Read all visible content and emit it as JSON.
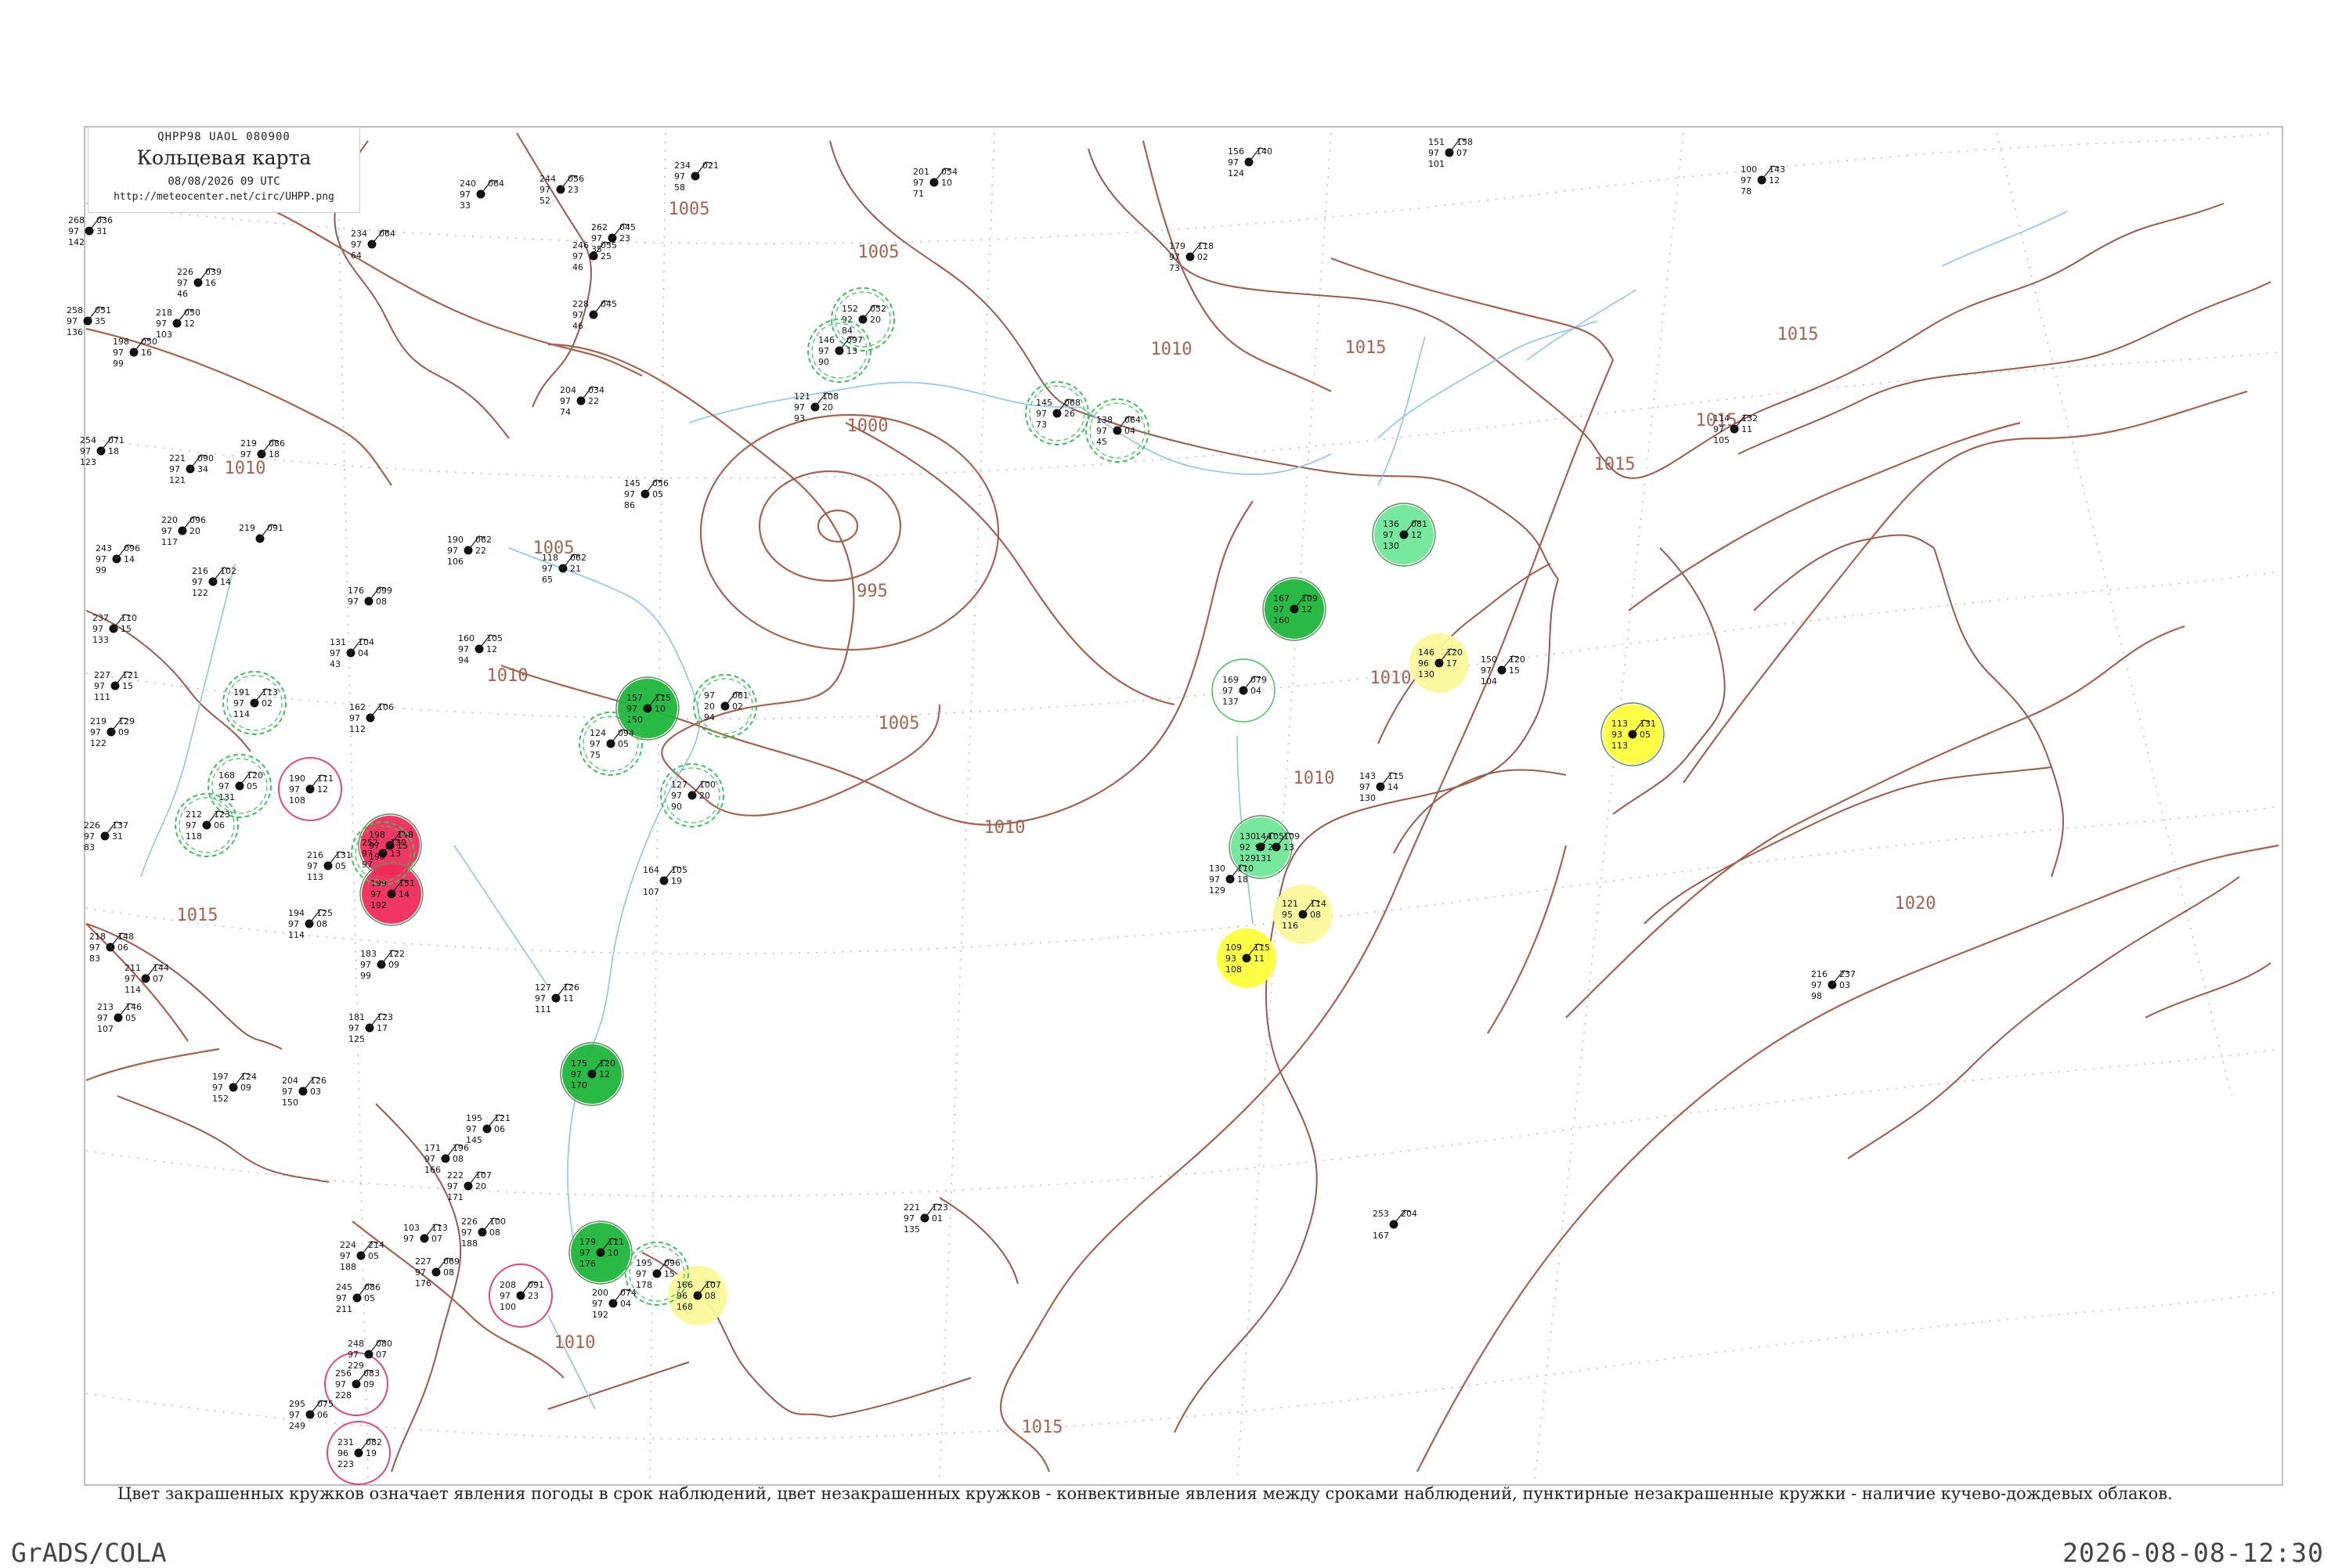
{
  "header": {
    "code": "QHPP98  UAOL  080900",
    "title": "Кольцевая карта",
    "date": "08/08/2026 09 UTC",
    "url": "http://meteocenter.net/circ/UHPP.png"
  },
  "caption": "Цвет закрашенных кружков означает явления погоды в срок наблюдений, цвет незакрашенных кружков - конвективные явления между сроками наблюдений, пунктирные незакрашенные кружки - наличие кучево-дождевых облаков.",
  "footer": {
    "left": "GrADS/COLA",
    "right": "2026-08-08-12:30"
  },
  "colors": {
    "isobar": "#a5624f",
    "river": "#8fc3e8",
    "coast": "#9a5a4a",
    "grid": "#b0b0b0",
    "shower_green": "#1cb63a",
    "light_green": "#6fe89a",
    "rain_yellow": "#ffff3c",
    "pale_yellow": "#fbf89a",
    "thunder_red": "#ef2b5a",
    "dashed_cb": "#3fbf5a",
    "pink_ring": "#e0487a"
  },
  "isobar_labels": [
    "1005",
    "1005",
    "1010",
    "1010",
    "1000",
    "995",
    "1005",
    "1010",
    "1015",
    "1015",
    "1015",
    "1015",
    "1010",
    "1010",
    "1010",
    "1015",
    "1020",
    "1005",
    "1010",
    "1015"
  ],
  "stations": [
    {
      "t": "136",
      "p": "081",
      "v": "97",
      "d": "130",
      "x": "12",
      "fill": "light",
      "ring": "solid"
    },
    {
      "t": "167",
      "p": "109",
      "v": "97",
      "d": "160",
      "x": "12",
      "fill": "green",
      "ring": "solid"
    },
    {
      "t": "146",
      "p": "120",
      "v": "96",
      "d": "130",
      "x": "17",
      "fill": "paleyellow",
      "ring": "none"
    },
    {
      "t": "113",
      "p": "131",
      "v": "93",
      "d": "113",
      "x": "05",
      "fill": "yellow",
      "ring": "solid"
    },
    {
      "t": "130",
      "p": "105",
      "v": "92",
      "d": "129",
      "x": "22",
      "fill": "light",
      "ring": "solid"
    },
    {
      "t": "121",
      "p": "114",
      "v": "95",
      "d": "116",
      "x": "08",
      "fill": "paleyellow",
      "ring": "none"
    },
    {
      "t": "109",
      "p": "115",
      "v": "93",
      "d": "108",
      "x": "11",
      "fill": "yellow",
      "ring": "none"
    },
    {
      "t": "157",
      "p": "115",
      "v": "97",
      "d": "150",
      "x": "10",
      "fill": "green",
      "ring": "solid"
    },
    {
      "t": "179",
      "p": "111",
      "v": "97",
      "d": "176",
      "x": "10",
      "fill": "green",
      "ring": "solid"
    },
    {
      "t": "175",
      "p": "120",
      "v": "97",
      "d": "170",
      "x": "12",
      "fill": "green",
      "ring": "solid"
    },
    {
      "t": "198",
      "p": "148",
      "v": "97",
      "d": "190",
      "x": "15",
      "fill": "red",
      "ring": "solid"
    },
    {
      "t": "199",
      "p": "151",
      "v": "97",
      "d": "192",
      "x": "14",
      "fill": "red",
      "ring": "solid"
    },
    {
      "t": "166",
      "p": "107",
      "v": "96",
      "d": "168",
      "x": "08",
      "fill": "paleyellow",
      "ring": "none"
    },
    {
      "t": "152",
      "p": "052",
      "v": "92",
      "d": "84",
      "x": "20",
      "fill": "none",
      "ring": "dashed"
    },
    {
      "t": "146",
      "p": "097",
      "v": "97",
      "d": "90",
      "x": "13",
      "fill": "none",
      "ring": "dashed"
    },
    {
      "t": "145",
      "p": "068",
      "v": "97",
      "d": "73",
      "x": "26",
      "fill": "none",
      "ring": "dashed"
    },
    {
      "t": "138",
      "p": "064",
      "v": "97",
      "d": "45",
      "x": "04",
      "fill": "none",
      "ring": "dashed"
    },
    {
      "t": "169",
      "p": "079",
      "v": "97",
      "d": "137",
      "x": "04",
      "fill": "none",
      "ring": "solid"
    },
    {
      "t": "97",
      "p": "061",
      "v": "20",
      "d": "94",
      "x": "02",
      "fill": "none",
      "ring": "dashed"
    },
    {
      "t": "124",
      "p": "094",
      "v": "97",
      "d": "75",
      "x": "05",
      "fill": "none",
      "ring": "dashed"
    },
    {
      "t": "127",
      "p": "100",
      "v": "97",
      "d": "90",
      "x": "20",
      "fill": "none",
      "ring": "dashed"
    },
    {
      "t": "190",
      "p": "111",
      "v": "97",
      "d": "108",
      "x": "12",
      "fill": "none",
      "ring": "pink"
    },
    {
      "t": "168",
      "p": "120",
      "v": "97",
      "d": "131",
      "x": "05",
      "fill": "none",
      "ring": "dashed"
    },
    {
      "t": "212",
      "p": "123",
      "v": "97",
      "d": "118",
      "x": "06",
      "fill": "none",
      "ring": "dashed"
    },
    {
      "t": "191",
      "p": "113",
      "v": "97",
      "d": "114",
      "x": "02",
      "fill": "none",
      "ring": "dashed"
    },
    {
      "t": "252",
      "p": "130",
      "v": "97",
      "d": "97",
      "x": "13",
      "fill": "none",
      "ring": "dashed"
    },
    {
      "t": "208",
      "p": "091",
      "v": "97",
      "d": "100",
      "x": "23",
      "fill": "none",
      "ring": "pink"
    },
    {
      "t": "195",
      "p": "096",
      "v": "97",
      "d": "178",
      "x": "15",
      "fill": "none",
      "ring": "dashed"
    },
    {
      "t": "256",
      "p": "083",
      "v": "97",
      "d": "228",
      "x": "09",
      "fill": "none",
      "ring": "pink"
    },
    {
      "t": "231",
      "p": "082",
      "v": "96",
      "d": "223",
      "x": "19",
      "fill": "none",
      "ring": "pink"
    },
    {
      "t": "221",
      "p": "123",
      "v": "97",
      "d": "135",
      "x": "01",
      "fill": "none",
      "ring": "none"
    },
    {
      "t": "253",
      "p": "204",
      "v": "",
      "d": "167",
      "x": "",
      "fill": "none",
      "ring": "none"
    },
    {
      "t": "216",
      "p": "237",
      "v": "97",
      "d": "98",
      "x": "03",
      "fill": "none",
      "ring": "none"
    },
    {
      "t": "156",
      "p": "140",
      "v": "97",
      "d": "124",
      "x": "",
      "fill": "none",
      "ring": "none"
    },
    {
      "t": "151",
      "p": "158",
      "v": "97",
      "d": "101",
      "x": "07",
      "fill": "none",
      "ring": "none"
    },
    {
      "t": "100",
      "p": "143",
      "v": "97",
      "d": "78",
      "x": "12",
      "fill": "none",
      "ring": "none"
    },
    {
      "t": "114",
      "p": "132",
      "v": "97",
      "d": "105",
      "x": "11",
      "fill": "none",
      "ring": "none"
    },
    {
      "t": "143",
      "p": "115",
      "v": "97",
      "d": "130",
      "x": "14",
      "fill": "none",
      "ring": "none"
    },
    {
      "t": "150",
      "p": "120",
      "v": "97",
      "d": "104",
      "x": "15",
      "fill": "none",
      "ring": "none"
    },
    {
      "t": "144",
      "p": "109",
      "v": "97",
      "d": "131",
      "x": "13",
      "fill": "none",
      "ring": "none"
    },
    {
      "t": "130",
      "p": "110",
      "v": "97",
      "d": "129",
      "x": "18",
      "fill": "none",
      "ring": "none"
    },
    {
      "t": "201",
      "p": "054",
      "v": "97",
      "d": "71",
      "x": "10",
      "fill": "none",
      "ring": "none"
    },
    {
      "t": "179",
      "p": "118",
      "v": "97",
      "d": "73",
      "x": "02",
      "fill": "none",
      "ring": "none"
    },
    {
      "t": "121",
      "p": "108",
      "v": "97",
      "d": "93",
      "x": "20",
      "fill": "none",
      "ring": "none"
    },
    {
      "t": "145",
      "p": "056",
      "v": "97",
      "d": "86",
      "x": "05",
      "fill": "none",
      "ring": "none"
    },
    {
      "t": "234",
      "p": "021",
      "v": "97",
      "d": "58",
      "x": "",
      "fill": "none",
      "ring": "none"
    },
    {
      "t": "240",
      "p": "064",
      "v": "97",
      "d": "33",
      "x": "",
      "fill": "none",
      "ring": "none"
    },
    {
      "t": "244",
      "p": "056",
      "v": "97",
      "d": "52",
      "x": "23",
      "fill": "none",
      "ring": "none"
    },
    {
      "t": "262",
      "p": "045",
      "v": "97",
      "d": "35",
      "x": "23",
      "fill": "none",
      "ring": "none"
    },
    {
      "t": "246",
      "p": "055",
      "v": "97",
      "d": "46",
      "x": "25",
      "fill": "none",
      "ring": "none"
    },
    {
      "t": "228",
      "p": "045",
      "v": "97",
      "d": "46",
      "x": "",
      "fill": "none",
      "ring": "none"
    },
    {
      "t": "204",
      "p": "034",
      "v": "97",
      "d": "74",
      "x": "22",
      "fill": "none",
      "ring": "none"
    },
    {
      "t": "268",
      "p": "036",
      "v": "97",
      "d": "142",
      "x": "31",
      "fill": "none",
      "ring": "none"
    },
    {
      "t": "234",
      "p": "064",
      "v": "97",
      "d": "64",
      "x": "",
      "fill": "none",
      "ring": "none"
    },
    {
      "t": "226",
      "p": "039",
      "v": "97",
      "d": "46",
      "x": "16",
      "fill": "none",
      "ring": "none"
    },
    {
      "t": "258",
      "p": "051",
      "v": "97",
      "d": "136",
      "x": "35",
      "fill": "none",
      "ring": "none"
    },
    {
      "t": "218",
      "p": "050",
      "v": "97",
      "d": "103",
      "x": "12",
      "fill": "none",
      "ring": "none"
    },
    {
      "t": "198",
      "p": "050",
      "v": "97",
      "d": "99",
      "x": "16",
      "fill": "none",
      "ring": "none"
    },
    {
      "t": "254",
      "p": "071",
      "v": "97",
      "d": "123",
      "x": "18",
      "fill": "none",
      "ring": "none"
    },
    {
      "t": "221",
      "p": "090",
      "v": "97",
      "d": "121",
      "x": "34",
      "fill": "none",
      "ring": "none"
    },
    {
      "t": "219",
      "p": "086",
      "v": "97",
      "d": "",
      "x": "18",
      "fill": "none",
      "ring": "none"
    },
    {
      "t": "220",
      "p": "096",
      "v": "97",
      "d": "117",
      "x": "20",
      "fill": "none",
      "ring": "none"
    },
    {
      "t": "243",
      "p": "096",
      "v": "97",
      "d": "99",
      "x": "14",
      "fill": "none",
      "ring": "none"
    },
    {
      "t": "219",
      "p": "091",
      "v": "",
      "d": "",
      "x": "",
      "fill": "none",
      "ring": "none"
    },
    {
      "t": "216",
      "p": "102",
      "v": "97",
      "d": "122",
      "x": "14",
      "fill": "none",
      "ring": "none"
    },
    {
      "t": "237",
      "p": "110",
      "v": "97",
      "d": "133",
      "x": "15",
      "fill": "none",
      "ring": "none"
    },
    {
      "t": "176",
      "p": "099",
      "v": "97",
      "d": "",
      "x": "08",
      "fill": "none",
      "ring": "none"
    },
    {
      "t": "190",
      "p": "062",
      "v": "97",
      "d": "106",
      "x": "22",
      "fill": "none",
      "ring": "none"
    },
    {
      "t": "118",
      "p": "062",
      "v": "97",
      "d": "65",
      "x": "21",
      "fill": "none",
      "ring": "none"
    },
    {
      "t": "160",
      "p": "105",
      "v": "97",
      "d": "94",
      "x": "12",
      "fill": "none",
      "ring": "none"
    },
    {
      "t": "131",
      "p": "104",
      "v": "97",
      "d": "43",
      "x": "04",
      "fill": "none",
      "ring": "none"
    },
    {
      "t": "227",
      "p": "121",
      "v": "97",
      "d": "111",
      "x": "15",
      "fill": "none",
      "ring": "none"
    },
    {
      "t": "219",
      "p": "129",
      "v": "97",
      "d": "122",
      "x": "09",
      "fill": "none",
      "ring": "none"
    },
    {
      "t": "226",
      "p": "137",
      "v": "97",
      "d": "83",
      "x": "31",
      "fill": "none",
      "ring": "none"
    },
    {
      "t": "162",
      "p": "106",
      "v": "97",
      "d": "112",
      "x": "",
      "fill": "none",
      "ring": "none"
    },
    {
      "t": "216",
      "p": "131",
      "v": "97",
      "d": "113",
      "x": "05",
      "fill": "none",
      "ring": "none"
    },
    {
      "t": "194",
      "p": "125",
      "v": "97",
      "d": "114",
      "x": "08",
      "fill": "none",
      "ring": "none"
    },
    {
      "t": "183",
      "p": "122",
      "v": "97",
      "d": "99",
      "x": "09",
      "fill": "none",
      "ring": "none"
    },
    {
      "t": "181",
      "p": "123",
      "v": "97",
      "d": "125",
      "x": "17",
      "fill": "none",
      "ring": "none"
    },
    {
      "t": "204",
      "p": "126",
      "v": "97",
      "d": "150",
      "x": "03",
      "fill": "none",
      "ring": "none"
    },
    {
      "t": "197",
      "p": "124",
      "v": "97",
      "d": "152",
      "x": "09",
      "fill": "none",
      "ring": "none"
    },
    {
      "t": "213",
      "p": "146",
      "v": "97",
      "d": "107",
      "x": "05",
      "fill": "none",
      "ring": "none"
    },
    {
      "t": "211",
      "p": "144",
      "v": "97",
      "d": "114",
      "x": "07",
      "fill": "none",
      "ring": "none"
    },
    {
      "t": "218",
      "p": "148",
      "v": "97",
      "d": "83",
      "x": "06",
      "fill": "none",
      "ring": "none"
    },
    {
      "t": "127",
      "p": "126",
      "v": "97",
      "d": "111",
      "x": "11",
      "fill": "none",
      "ring": "none"
    },
    {
      "t": "164",
      "p": "105",
      "v": "",
      "d": "107",
      "x": "19",
      "fill": "none",
      "ring": "none"
    },
    {
      "t": "195",
      "p": "121",
      "v": "97",
      "d": "145",
      "x": "06",
      "fill": "none",
      "ring": "none"
    },
    {
      "t": "171",
      "p": "196",
      "v": "97",
      "d": "166",
      "x": "08",
      "fill": "none",
      "ring": "none"
    },
    {
      "t": "222",
      "p": "107",
      "v": "97",
      "d": "171",
      "x": "20",
      "fill": "none",
      "ring": "none"
    },
    {
      "t": "226",
      "p": "100",
      "v": "97",
      "d": "188",
      "x": "08",
      "fill": "none",
      "ring": "none"
    },
    {
      "t": "224",
      "p": "214",
      "v": "97",
      "d": "188",
      "x": "05",
      "fill": "none",
      "ring": "none"
    },
    {
      "t": "103",
      "p": "113",
      "v": "97",
      "d": "",
      "x": "07",
      "fill": "none",
      "ring": "none"
    },
    {
      "t": "227",
      "p": "069",
      "v": "97",
      "d": "176",
      "x": "08",
      "fill": "none",
      "ring": "none"
    },
    {
      "t": "245",
      "p": "086",
      "v": "97",
      "d": "211",
      "x": "05",
      "fill": "none",
      "ring": "none"
    },
    {
      "t": "248",
      "p": "080",
      "v": "97",
      "d": "229",
      "x": "07",
      "fill": "none",
      "ring": "none"
    },
    {
      "t": "295",
      "p": "075",
      "v": "97",
      "d": "249",
      "x": "06",
      "fill": "none",
      "ring": "none"
    },
    {
      "t": "200",
      "p": "074",
      "v": "97",
      "d": "192",
      "x": "04",
      "fill": "none",
      "ring": "none"
    }
  ]
}
